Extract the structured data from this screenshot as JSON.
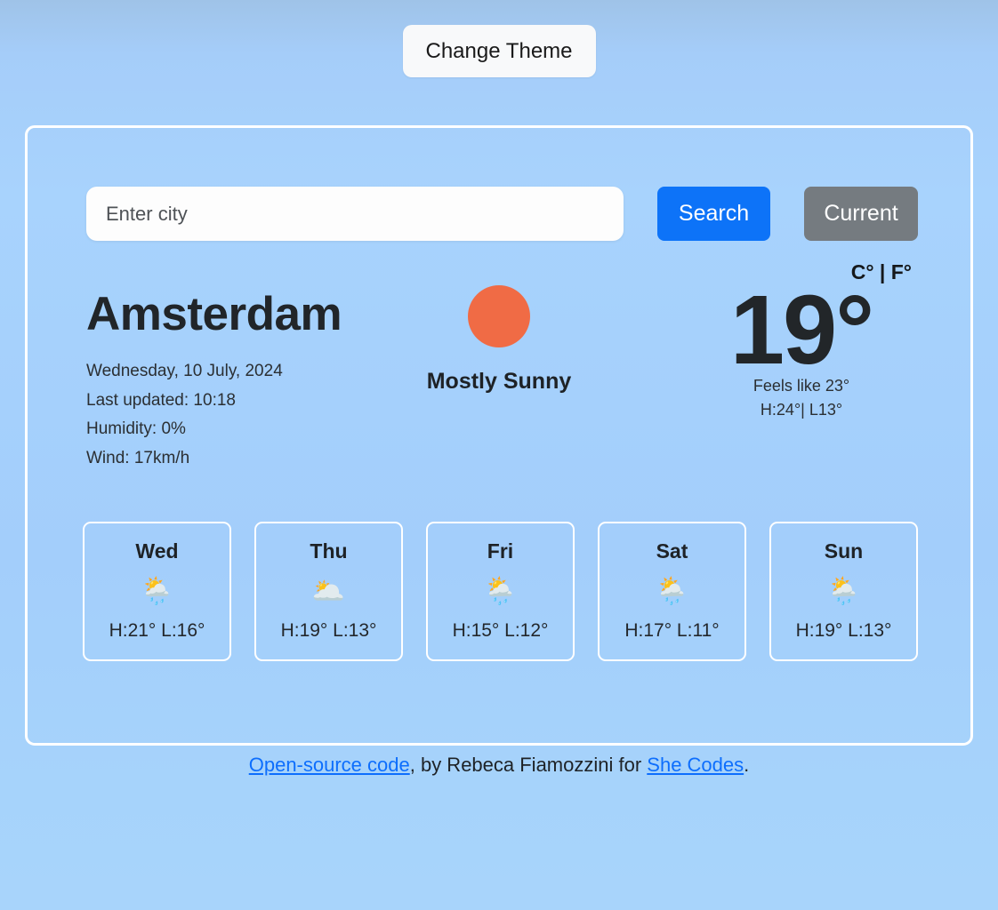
{
  "theme": {
    "button_label": "Change Theme"
  },
  "search": {
    "placeholder": "Enter city",
    "value": "",
    "search_label": "Search",
    "current_label": "Current"
  },
  "current": {
    "city": "Amsterdam",
    "date": "Wednesday, 10 July, 2024",
    "last_updated": "Last updated: 10:18",
    "humidity": "Humidity: 0%",
    "wind": "Wind: 17km/h",
    "condition": "Mostly Sunny",
    "condition_icon": "sun-circle",
    "unit_toggle": "C° | F°",
    "temperature": "19°",
    "feels_like": "Feels like 23°",
    "hi_lo": "H:24°| L13°"
  },
  "forecast": [
    {
      "day": "Wed",
      "icon": "🌦️",
      "icon_name": "sun-behind-rain-cloud-icon",
      "temps": "H:21° L:16°"
    },
    {
      "day": "Thu",
      "icon": "🌥️",
      "icon_name": "sun-behind-large-cloud-icon",
      "temps": "H:19° L:13°"
    },
    {
      "day": "Fri",
      "icon": "🌦️",
      "icon_name": "sun-behind-rain-cloud-icon",
      "temps": "H:15° L:12°"
    },
    {
      "day": "Sat",
      "icon": "🌦️",
      "icon_name": "sun-behind-rain-cloud-icon",
      "temps": "H:17° L:11°"
    },
    {
      "day": "Sun",
      "icon": "🌦️",
      "icon_name": "sun-behind-rain-cloud-icon",
      "temps": "H:19° L:13°"
    }
  ],
  "footer": {
    "link1": "Open-source code",
    "mid": ", by Rebeca Fiamozzini for ",
    "link2": "She Codes",
    "end": "."
  },
  "colors": {
    "accent_blue": "#0d73f8",
    "gray_button": "#757b80",
    "sun_orange": "#f06b45",
    "link_blue": "#0d6efd",
    "card_border": "#ffffff"
  }
}
